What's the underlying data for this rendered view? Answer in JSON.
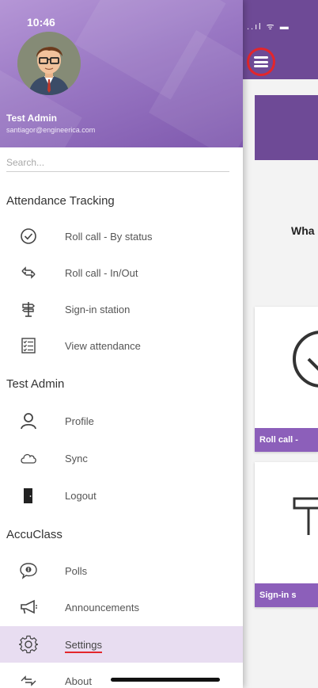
{
  "status_bar": {
    "time": "10:46",
    "right_icons": "..ıl ᯤ ▬"
  },
  "header": {
    "user_name": "Test Admin",
    "user_email": "santiagor@engineerica.com"
  },
  "search": {
    "placeholder": "Search..."
  },
  "sections": {
    "attendance": {
      "title": "Attendance Tracking",
      "items": [
        {
          "label": "Roll call - By status",
          "icon": "check-circle-icon"
        },
        {
          "label": "Roll call - In/Out",
          "icon": "swap-arrows-icon"
        },
        {
          "label": "Sign-in station",
          "icon": "signpost-icon"
        },
        {
          "label": "View attendance",
          "icon": "checklist-icon"
        }
      ]
    },
    "account": {
      "title": "Test Admin",
      "items": [
        {
          "label": "Profile",
          "icon": "person-icon"
        },
        {
          "label": "Sync",
          "icon": "cloud-icon"
        },
        {
          "label": "Logout",
          "icon": "door-icon"
        }
      ]
    },
    "accuclass": {
      "title": "AccuClass",
      "items": [
        {
          "label": "Polls",
          "icon": "poll-bubble-icon"
        },
        {
          "label": "Announcements",
          "icon": "megaphone-icon"
        },
        {
          "label": "Settings",
          "icon": "gear-icon",
          "active": true
        },
        {
          "label": "About",
          "icon": "about-icon"
        }
      ]
    }
  },
  "background": {
    "question_text": "Wha",
    "cards": [
      {
        "label": "Roll call -"
      },
      {
        "label": "Sign-in s"
      }
    ]
  },
  "colors": {
    "brand_purple": "#6e4a96",
    "card_footer": "#8c5fba",
    "active_item_bg": "#e8ddf1",
    "highlight_red": "#e3262c"
  }
}
